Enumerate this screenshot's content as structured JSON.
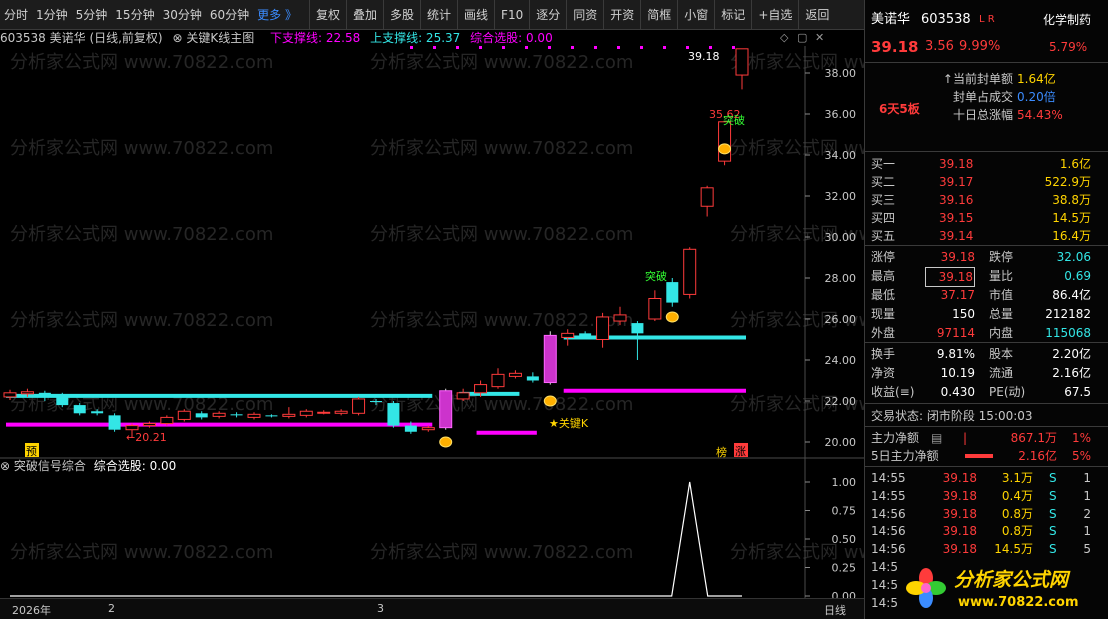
{
  "toolbar": {
    "periods": [
      "分时",
      "1分钟",
      "5分钟",
      "15分钟",
      "30分钟",
      "60分钟",
      "更多 》"
    ],
    "buttons": [
      "复权",
      "叠加",
      "多股",
      "统计",
      "画线",
      "F10",
      "逐分",
      "同资",
      "开资",
      "简框",
      "小窗",
      "标记",
      "+自选",
      "返回"
    ]
  },
  "chart_header": {
    "stock": "603538 美诺华 (日线,前复权)",
    "indicator": "关键K线主图",
    "lower_support": "下支撑线: 22.58",
    "upper_support": "上支撑线: 25.37",
    "composite": "综合选股: 0.00"
  },
  "sub_header": {
    "indicator": "突破信号综合",
    "value": "综合选股: 0.00"
  },
  "annotations": {
    "high_label": "39.18",
    "mid_label": "35.62",
    "low_label": "←20.21",
    "breakout_1": "突破",
    "breakout_2": "突破",
    "key_k": "★关键K",
    "yu": "预",
    "bang": "榜",
    "zhang": "涨"
  },
  "watermark": "分析家公式网 www.70822.com",
  "x_axis": {
    "year": "2026年",
    "m2": "2",
    "m3": "3",
    "period": "日线"
  },
  "chart_data": {
    "type": "candlestick",
    "price_axis": {
      "min": 20.0,
      "max": 38.0,
      "ticks": [
        20.0,
        22.0,
        24.0,
        26.0,
        28.0,
        30.0,
        32.0,
        34.0,
        36.0,
        38.0
      ]
    },
    "candles": [
      {
        "o": 22.2,
        "c": 22.4,
        "h": 22.55,
        "l": 22.05
      },
      {
        "o": 22.35,
        "c": 22.45,
        "h": 22.6,
        "l": 22.2
      },
      {
        "o": 22.4,
        "c": 22.25,
        "h": 22.5,
        "l": 22.0
      },
      {
        "o": 22.3,
        "c": 21.8,
        "h": 22.4,
        "l": 21.7
      },
      {
        "o": 21.8,
        "c": 21.4,
        "h": 21.9,
        "l": 21.3
      },
      {
        "o": 21.5,
        "c": 21.4,
        "h": 21.6,
        "l": 21.3
      },
      {
        "o": 21.3,
        "c": 20.6,
        "h": 21.4,
        "l": 20.5
      },
      {
        "o": 20.6,
        "c": 20.8,
        "h": 20.9,
        "l": 20.21
      },
      {
        "o": 20.8,
        "c": 20.9,
        "h": 21.0,
        "l": 20.7
      },
      {
        "o": 20.9,
        "c": 21.2,
        "h": 21.3,
        "l": 20.8
      },
      {
        "o": 21.1,
        "c": 21.5,
        "h": 21.6,
        "l": 21.0
      },
      {
        "o": 21.4,
        "c": 21.2,
        "h": 21.5,
        "l": 21.1
      },
      {
        "o": 21.25,
        "c": 21.4,
        "h": 21.5,
        "l": 21.15
      },
      {
        "o": 21.35,
        "c": 21.3,
        "h": 21.45,
        "l": 21.2
      },
      {
        "o": 21.2,
        "c": 21.35,
        "h": 21.45,
        "l": 21.1
      },
      {
        "o": 21.3,
        "c": 21.25,
        "h": 21.35,
        "l": 21.2
      },
      {
        "o": 21.25,
        "c": 21.35,
        "h": 21.7,
        "l": 21.15
      },
      {
        "o": 21.3,
        "c": 21.5,
        "h": 21.6,
        "l": 21.2
      },
      {
        "o": 21.45,
        "c": 21.45,
        "h": 21.55,
        "l": 21.35
      },
      {
        "o": 21.4,
        "c": 21.5,
        "h": 21.6,
        "l": 21.3
      },
      {
        "o": 21.4,
        "c": 22.1,
        "h": 22.2,
        "l": 21.3
      },
      {
        "o": 22.0,
        "c": 21.95,
        "h": 22.1,
        "l": 21.8
      },
      {
        "o": 21.9,
        "c": 20.8,
        "h": 22.0,
        "l": 20.7
      },
      {
        "o": 20.8,
        "c": 20.5,
        "h": 21.0,
        "l": 20.4
      },
      {
        "o": 20.6,
        "c": 20.7,
        "h": 20.8,
        "l": 20.5
      },
      {
        "o": 20.7,
        "c": 22.5,
        "h": 22.6,
        "l": 20.6
      },
      {
        "o": 22.1,
        "c": 22.4,
        "h": 22.6,
        "l": 22.0
      },
      {
        "o": 22.4,
        "c": 22.8,
        "h": 23.0,
        "l": 22.2
      },
      {
        "o": 22.7,
        "c": 23.3,
        "h": 23.6,
        "l": 22.6
      },
      {
        "o": 23.2,
        "c": 23.35,
        "h": 23.5,
        "l": 23.1
      },
      {
        "o": 23.2,
        "c": 23.0,
        "h": 23.4,
        "l": 22.9
      },
      {
        "o": 22.9,
        "c": 25.2,
        "h": 25.4,
        "l": 22.8
      },
      {
        "o": 25.1,
        "c": 25.3,
        "h": 25.5,
        "l": 24.7
      },
      {
        "o": 25.3,
        "c": 25.1,
        "h": 25.4,
        "l": 25.0
      },
      {
        "o": 25.0,
        "c": 26.1,
        "h": 26.3,
        "l": 24.6
      },
      {
        "o": 25.9,
        "c": 26.2,
        "h": 26.6,
        "l": 25.7
      },
      {
        "o": 25.8,
        "c": 25.3,
        "h": 25.9,
        "l": 24.0
      },
      {
        "o": 26.0,
        "c": 27.0,
        "h": 27.4,
        "l": 25.9
      },
      {
        "o": 27.8,
        "c": 26.8,
        "h": 28.0,
        "l": 26.6
      },
      {
        "o": 27.2,
        "c": 29.4,
        "h": 29.5,
        "l": 27.0
      },
      {
        "o": 31.5,
        "c": 32.4,
        "h": 32.5,
        "l": 31.0
      },
      {
        "o": 33.7,
        "c": 35.62,
        "h": 35.62,
        "l": 33.5
      },
      {
        "o": 37.9,
        "c": 39.18,
        "h": 39.18,
        "l": 37.2
      }
    ],
    "signal": {
      "axis": [
        0.0,
        0.25,
        0.5,
        0.75,
        1.0
      ],
      "peak_index": 39,
      "peak_value": 1.0
    }
  },
  "right_panel": {
    "name": "美诺华",
    "code": "603538",
    "flags": "L R",
    "sector": "化学制药",
    "price": "39.18",
    "change": "3.56",
    "change_pct": "9.99%",
    "sector_pct": "5.79%",
    "board_days": "6天5板",
    "seal": [
      {
        "label": "当前封单额",
        "value": "1.64亿"
      },
      {
        "label": "封单占成交",
        "value": "0.20倍"
      },
      {
        "label": "十日总涨幅",
        "value": "54.43%"
      }
    ],
    "bids": [
      {
        "label": "买一",
        "price": "39.18",
        "vol": "1.6亿"
      },
      {
        "label": "买二",
        "price": "39.17",
        "vol": "522.9万"
      },
      {
        "label": "买三",
        "price": "39.16",
        "vol": "38.8万"
      },
      {
        "label": "买四",
        "price": "39.15",
        "vol": "14.5万"
      },
      {
        "label": "买五",
        "price": "39.14",
        "vol": "16.4万"
      }
    ],
    "stats": [
      {
        "l1": "涨停",
        "v1": "39.18",
        "l2": "跌停",
        "v2": "32.06"
      },
      {
        "l1": "最高",
        "v1": "39.18",
        "l2": "量比",
        "v2": "0.69"
      },
      {
        "l1": "最低",
        "v1": "37.17",
        "l2": "市值",
        "v2": "86.4亿"
      },
      {
        "l1": "现量",
        "v1": "150",
        "l2": "总量",
        "v2": "212182"
      },
      {
        "l1": "外盘",
        "v1": "97114",
        "l2": "内盘",
        "v2": "115068"
      }
    ],
    "fundamentals": [
      {
        "l1": "换手",
        "v1": "9.81%",
        "l2": "股本",
        "v2": "2.20亿"
      },
      {
        "l1": "净资",
        "v1": "10.19",
        "l2": "流通",
        "v2": "2.16亿"
      },
      {
        "l1": "收益(≡)",
        "v1": "0.430",
        "l2": "PE(动)",
        "v2": "67.5"
      }
    ],
    "trade_status": "交易状态: 闭市阶段 15:00:03",
    "main_flow": {
      "label": "主力净额",
      "value": "867.1万",
      "pct": "1%"
    },
    "main_flow_5d": {
      "label": "5日主力净额",
      "value": "2.16亿",
      "pct": "5%"
    },
    "ticks": [
      {
        "time": "14:55",
        "price": "39.18",
        "vol": "3.1万",
        "bs": "S",
        "n": "1"
      },
      {
        "time": "14:55",
        "price": "39.18",
        "vol": "0.4万",
        "bs": "S",
        "n": "1"
      },
      {
        "time": "14:56",
        "price": "39.18",
        "vol": "0.8万",
        "bs": "S",
        "n": "2"
      },
      {
        "time": "14:56",
        "price": "39.18",
        "vol": "0.8万",
        "bs": "S",
        "n": "1"
      },
      {
        "time": "14:56",
        "price": "39.18",
        "vol": "14.5万",
        "bs": "S",
        "n": "5"
      },
      {
        "time": "14:5",
        "price": "",
        "vol": "",
        "bs": "",
        "n": ""
      },
      {
        "time": "14:5",
        "price": "",
        "vol": "",
        "bs": "",
        "n": ""
      },
      {
        "time": "14:5",
        "price": "",
        "vol": "",
        "bs": "",
        "n": ""
      }
    ]
  },
  "logo": {
    "text": "分析家公式网",
    "url": "www.70822.com"
  },
  "colors": {
    "up": "#ff3b3b",
    "down": "#33e6e6",
    "support_upper": "#33e6e6",
    "support_lower": "#ff00ff",
    "highlight": "#cc33cc"
  }
}
